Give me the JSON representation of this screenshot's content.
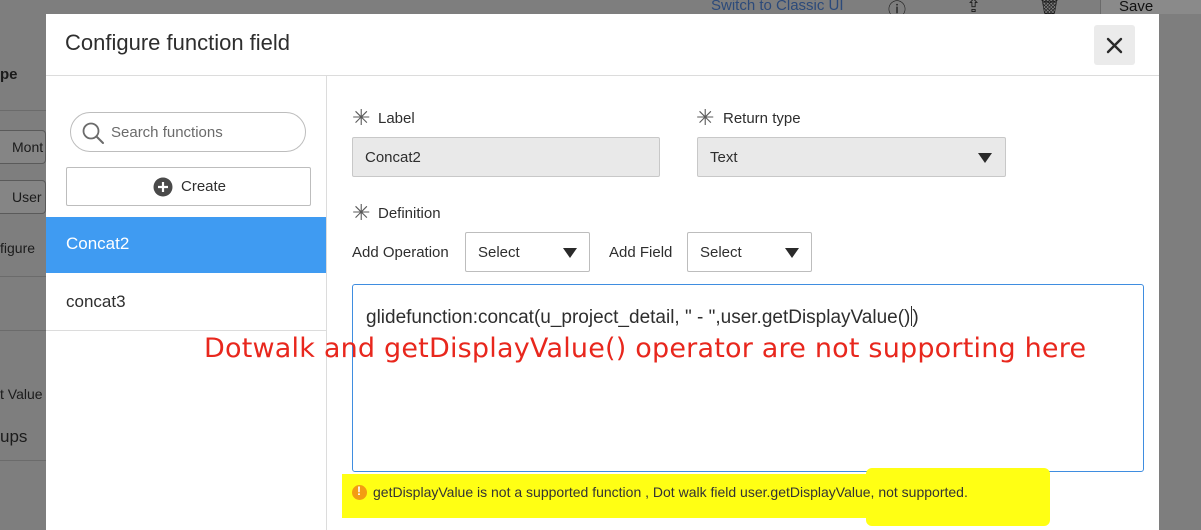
{
  "background": {
    "top_link": "Switch to Classic UI",
    "save_label": "Save",
    "side_texts": [
      "pe",
      "Mont",
      "User",
      "figure",
      "t Value",
      "ups"
    ]
  },
  "modal": {
    "title": "Configure function field",
    "close_icon": "close-icon"
  },
  "left_pane": {
    "search_placeholder": "Search functions",
    "create_label": "Create",
    "functions": [
      {
        "label": "Concat2",
        "active": true
      },
      {
        "label": "concat3",
        "active": false
      }
    ]
  },
  "form": {
    "label_title": "Label",
    "label_value": "Concat2",
    "return_type_title": "Return type",
    "return_type_value": "Text",
    "definition_title": "Definition",
    "add_operation_label": "Add Operation",
    "add_operation_value": "Select",
    "add_field_label": "Add Field",
    "add_field_value": "Select",
    "definition_value": "glidefunction:concat(u_project_detail, \" - \",user.getDisplayValue()"
  },
  "annotation": "Dotwalk and getDisplayValue() operator are not supporting here",
  "error": {
    "message": "getDisplayValue is not a supported function , Dot walk field user.getDisplayValue, not supported.",
    "icon": "warning-icon",
    "color": "#f39c12"
  },
  "colors": {
    "accent": "#3f9bf2",
    "annotation": "#e8271d",
    "highlight": "#ffff14"
  }
}
